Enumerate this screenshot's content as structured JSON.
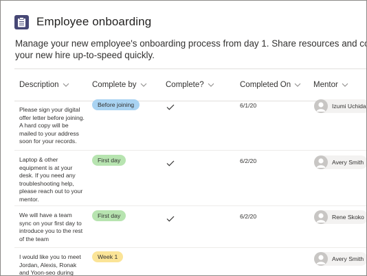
{
  "app": {
    "title": "Employee onboarding",
    "icon": "clipboard-list-icon",
    "description_line1": "Manage your new employee's onboarding process from day 1. Share resources and contacts, and get",
    "description_line2": "your new hire up-to-speed quickly."
  },
  "columns": [
    {
      "label": "Description"
    },
    {
      "label": "Complete by"
    },
    {
      "label": "Complete?"
    },
    {
      "label": "Completed On"
    },
    {
      "label": "Mentor"
    }
  ],
  "rows": [
    {
      "description": "Please sign your digital offer letter before joining. A hard copy will be mailed to your address soon for your records.",
      "complete_by": "Before joining",
      "complete_by_color": "#a9d3f2",
      "complete": "✓",
      "completed_on": "6/1/20",
      "mentor": "Izumi Uchida"
    },
    {
      "description": "Laptop & other equipment is at your desk. If you need any troubleshooting help, please reach out to your mentor.",
      "complete_by": "First day",
      "complete_by_color": "#b7e4b0",
      "complete": "✓",
      "completed_on": "6/2/20",
      "mentor": "Avery Smith"
    },
    {
      "description": "We will have a team sync on your first day to introduce you to the rest of the team",
      "complete_by": "First day",
      "complete_by_color": "#b7e4b0",
      "complete": "✓",
      "completed_on": "6/2/20",
      "mentor": "Rene Skoko"
    },
    {
      "description": "I would like you to meet Jordan, Alexis, Ronak and Yoon-seo during",
      "complete_by": "Week 1",
      "complete_by_color": "#fbe497",
      "complete": "",
      "completed_on": "",
      "mentor": "Avery Smith"
    }
  ],
  "colors": {
    "app_icon_bg": "#464775",
    "border": "#e1dfdd",
    "text": "#323130"
  }
}
